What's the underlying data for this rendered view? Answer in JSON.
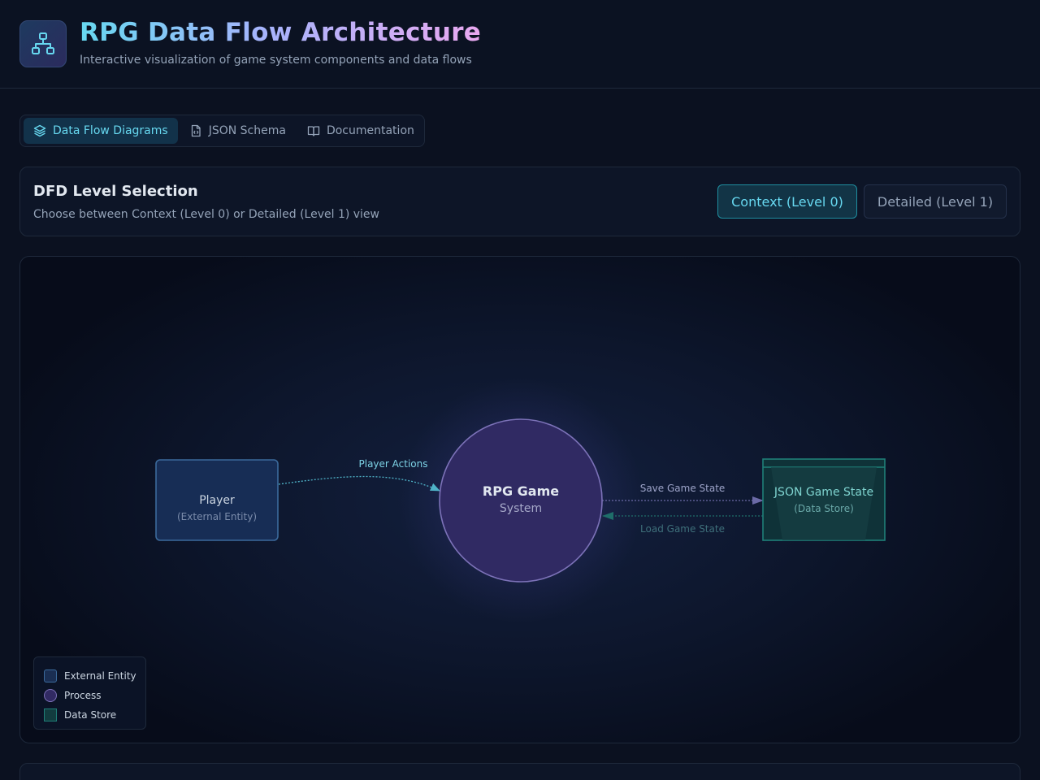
{
  "header": {
    "logo_icon": "network-hierarchy-icon",
    "title": "RPG Data Flow Architecture",
    "subtitle": "Interactive visualization of game system components and data flows"
  },
  "tabs": [
    {
      "label": "Data Flow Diagrams",
      "icon": "layers-icon",
      "active": true
    },
    {
      "label": "JSON Schema",
      "icon": "code-file-icon",
      "active": false
    },
    {
      "label": "Documentation",
      "icon": "book-icon",
      "active": false
    }
  ],
  "level_selection": {
    "title": "DFD Level Selection",
    "description": "Choose between Context (Level 0) or Detailed (Level 1) view",
    "buttons": [
      {
        "label": "Context (Level 0)",
        "active": true
      },
      {
        "label": "Detailed (Level 1)",
        "active": false
      }
    ]
  },
  "diagram": {
    "player": {
      "name": "Player",
      "type": "(External Entity)"
    },
    "process": {
      "name": "RPG Game",
      "type": "System"
    },
    "store": {
      "name": "JSON Game State",
      "type": "(Data Store)"
    },
    "flows": {
      "player_actions": "Player Actions",
      "save_state": "Save Game State",
      "load_state": "Load Game State"
    }
  },
  "legend": {
    "external_entity": "External Entity",
    "process": "Process",
    "data_store": "Data Store"
  },
  "colors": {
    "accent": "#67d8f0",
    "entity": "#3b6a9c",
    "process": "#7c72b8",
    "store": "#1f7f78"
  }
}
